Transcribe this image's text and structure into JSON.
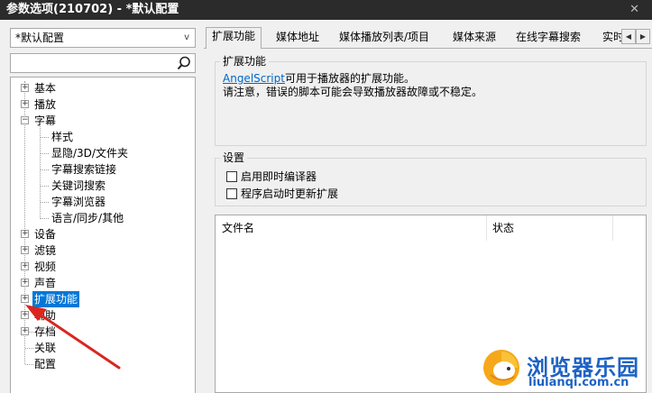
{
  "window": {
    "title": "参数选项(210702) - *默认配置",
    "close_glyph": "✕"
  },
  "profile_select": {
    "value": "*默认配置"
  },
  "search": {
    "placeholder": ""
  },
  "tree": {
    "items": [
      {
        "label": "基本",
        "expander": "+"
      },
      {
        "label": "播放",
        "expander": "+"
      },
      {
        "label": "字幕",
        "expander": "−"
      },
      {
        "label": "样式"
      },
      {
        "label": "显隐/3D/文件夹"
      },
      {
        "label": "字幕搜索链接"
      },
      {
        "label": "关键词搜索"
      },
      {
        "label": "字幕浏览器"
      },
      {
        "label": "语言/同步/其他"
      },
      {
        "label": "设备",
        "expander": "+"
      },
      {
        "label": "滤镜",
        "expander": "+"
      },
      {
        "label": "视频",
        "expander": "+"
      },
      {
        "label": "声音",
        "expander": "+"
      },
      {
        "label": "扩展功能",
        "expander": "+",
        "selected": true
      },
      {
        "label": "辅助",
        "expander": "+"
      },
      {
        "label": "存档",
        "expander": "+"
      },
      {
        "label": "关联"
      },
      {
        "label": "配置"
      }
    ]
  },
  "tabs": [
    {
      "label": "扩展功能",
      "active": true
    },
    {
      "label": "媒体地址"
    },
    {
      "label": "媒体播放列表/项目"
    },
    {
      "label": "媒体来源"
    },
    {
      "label": "在线字幕搜索"
    },
    {
      "label": "实时"
    }
  ],
  "tab_scroll": {
    "left": "◀",
    "right": "▶"
  },
  "extension_group": {
    "title": "扩展功能",
    "link_text": "AngelScript",
    "line1_rest": "可用于播放器的扩展功能。",
    "line2": "请注意，错误的脚本可能会导致播放器故障或不稳定。"
  },
  "settings_group": {
    "title": "设置",
    "options": [
      {
        "label": "启用即时编译器",
        "checked": false
      },
      {
        "label": "程序启动时更新扩展",
        "checked": false
      }
    ]
  },
  "file_list": {
    "columns": [
      "文件名",
      "状态"
    ],
    "rows": []
  },
  "watermark": {
    "title": "浏览器乐园",
    "url": "liulanqi.com.cn"
  },
  "colors": {
    "selection": "#0078d7",
    "link": "#0066cc",
    "annotation_arrow": "#d9271f",
    "watermark": "#1d62c4"
  }
}
